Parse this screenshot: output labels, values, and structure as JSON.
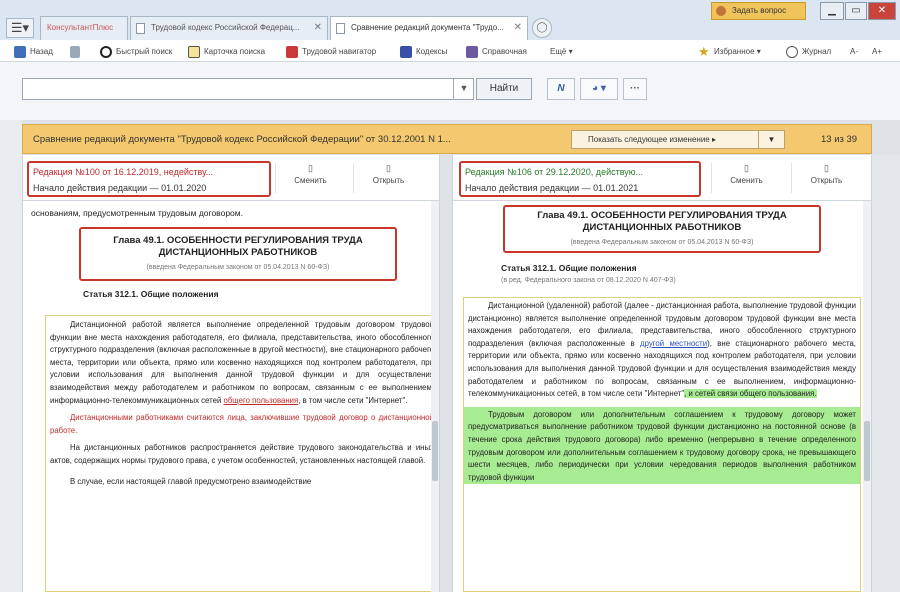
{
  "tabs": [
    {
      "label": "КонсультантПлюс",
      "active": false
    },
    {
      "label": "Трудовой кодекс Российской Федерац...",
      "active": false
    },
    {
      "label": "Сравнение редакций документа \"Трудо...",
      "active": true
    }
  ],
  "ask_button": "Задать вопрос",
  "toolbar": {
    "back": "Назад",
    "quick_search": "Быстрый поиск",
    "card_search": "Карточка поиска",
    "labor_navigator": "Трудовой навигатор",
    "codes": "Кодексы",
    "reference": "Справочная",
    "more": "Ещё",
    "favorites": "Избранное",
    "history": "Журнал",
    "zoom_minus": "A-",
    "zoom_plus": "A+"
  },
  "search": {
    "value": "",
    "placeholder": "",
    "find_label": "Найти"
  },
  "compare": {
    "title": "Сравнение редакций документа \"Трудовой кодекс Российской Федерации\" от 30.12.2001 N 1...",
    "show_next": "Показать следующее изменение",
    "counter": "13 из 39"
  },
  "left": {
    "edition_title": "Редакция №100 от 16.12.2019, недейству...",
    "edition_date": "Начало действия редакции — 01.01.2020",
    "change_btn": "Сменить",
    "open_btn": "Открыть",
    "top_line": "основаниям, предусмотренным трудовым договором.",
    "chapter": "Глава 49.1. ОСОБЕННОСТИ РЕГУЛИРОВАНИЯ ТРУДА ДИСТАНЦИОННЫХ РАБОТНИКОВ",
    "chapter_note": "(введена Федеральным законом от 05.04.2013 N 60-ФЗ)",
    "article": "Статья 312.1. Общие положения",
    "p1a": "Дистанционной работой является выполнение определенной трудовым договором трудовой функции вне места нахождения работодателя, его филиала, представительства, иного обособленного структурного подразделения (включая расположенные в другой местности), вне стационарного рабочего места, территории или объекта, прямо или косвенно находящихся под контролем работодателя, при условии использования для выполнения данной трудовой функции и для осуществления взаимодействия между работодателем и работником по вопросам, связанным с ее выполнением, информационно-телекоммуникационных сетей ",
    "p1b": "общего пользования",
    "p1c": ", в том числе сети \"Интернет\".",
    "p2a": "Дистанционными работниками считаются лица, заключившие трудовой договор ",
    "p2b": "о дистанционной работе.",
    "p3": "На дистанционных работников распространяется действие трудового законодательства и иных актов, содержащих нормы трудового права, с учетом особенностей, установленных настоящей главой.",
    "p4": "В случае, если настоящей главой предусмотрено взаимодействие"
  },
  "right": {
    "edition_title": "Редакция №106 от 29.12.2020, действую...",
    "edition_date": "Начало действия редакции — 01.01.2021",
    "change_btn": "Сменить",
    "open_btn": "Открыть",
    "chapter": "Глава 49.1. ОСОБЕННОСТИ РЕГУЛИРОВАНИЯ ТРУДА ДИСТАНЦИОННЫХ РАБОТНИКОВ",
    "chapter_note": "(введена Федеральным законом от 05.04.2013 N 60-ФЗ)",
    "article": "Статья 312.1. Общие положения",
    "article_note": "(в ред. Федерального закона от 08.12.2020 N 407-ФЗ)",
    "p1a": "Дистанционной (удаленной) работой (далее - дистанционная работа, выполнение трудовой функции дистанционно) является выполнение определенной трудовым договором трудовой функции вне места нахождения работодателя, его филиала, представительства, иного обособленного структурного подразделения (включая расположенные в ",
    "p1b": "другой местности",
    "p1c": "), вне стационарного рабочего места, территории или объекта, прямо или косвенно находящихся под контролем работодателя, при условии использования для выполнения данной трудовой функции и для осуществления взаимодействия между работодателем и работником по вопросам, связанным с ее выполнением, информационно-телекоммуникационных сетей, в том числе сети \"Интернет\"",
    "p1d": ", и сетей связи общего пользования.",
    "p2": "Трудовым договором или дополнительным соглашением к трудовому договору может предусматриваться выполнение работником трудовой функции дистанционно на постоянной основе (в течение срока действия трудового договора) либо временно (непрерывно в течение определенного трудовым договором или дополнительным соглашением к трудовому договору срока, не превышающего шести месяцев, либо периодически при условии чередования периодов выполнения работником трудовой функции"
  }
}
